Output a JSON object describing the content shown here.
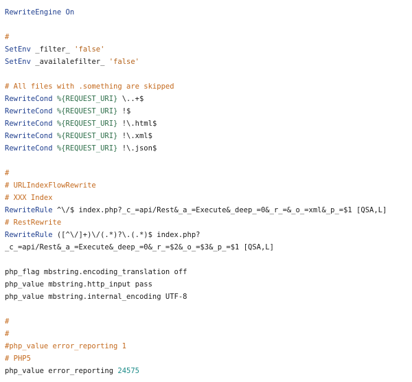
{
  "colors": {
    "keyword": "#1f3f8f",
    "string": "#b4621a",
    "comment": "#c46a1e",
    "variable": "#2f6f4b",
    "number": "#1b8b88",
    "text": "#1a1a1a"
  },
  "lines": [
    {
      "tokens": [
        {
          "t": "kw",
          "v": "RewriteEngine On"
        }
      ]
    },
    {
      "tokens": []
    },
    {
      "tokens": [
        {
          "t": "cm",
          "v": "#"
        }
      ]
    },
    {
      "tokens": [
        {
          "t": "kw",
          "v": "SetEnv "
        },
        {
          "t": "plain",
          "v": "_filter_ "
        },
        {
          "t": "str",
          "v": "'false'"
        }
      ]
    },
    {
      "tokens": [
        {
          "t": "kw",
          "v": "SetEnv "
        },
        {
          "t": "plain",
          "v": "_availalefilter_ "
        },
        {
          "t": "str",
          "v": "'false'"
        }
      ]
    },
    {
      "tokens": []
    },
    {
      "tokens": [
        {
          "t": "cm",
          "v": "# All files with .something are skipped"
        }
      ]
    },
    {
      "tokens": [
        {
          "t": "kw",
          "v": "RewriteCond "
        },
        {
          "t": "var",
          "v": "%{REQUEST_URI}"
        },
        {
          "t": "plain",
          "v": " \\..+$"
        }
      ]
    },
    {
      "tokens": [
        {
          "t": "kw",
          "v": "RewriteCond "
        },
        {
          "t": "var",
          "v": "%{REQUEST_URI}"
        },
        {
          "t": "plain",
          "v": " !$"
        }
      ]
    },
    {
      "tokens": [
        {
          "t": "kw",
          "v": "RewriteCond "
        },
        {
          "t": "var",
          "v": "%{REQUEST_URI}"
        },
        {
          "t": "plain",
          "v": " !\\.html$"
        }
      ]
    },
    {
      "tokens": [
        {
          "t": "kw",
          "v": "RewriteCond "
        },
        {
          "t": "var",
          "v": "%{REQUEST_URI}"
        },
        {
          "t": "plain",
          "v": " !\\.xml$"
        }
      ]
    },
    {
      "tokens": [
        {
          "t": "kw",
          "v": "RewriteCond "
        },
        {
          "t": "var",
          "v": "%{REQUEST_URI}"
        },
        {
          "t": "plain",
          "v": " !\\.json$"
        }
      ]
    },
    {
      "tokens": []
    },
    {
      "tokens": [
        {
          "t": "cm",
          "v": "#"
        }
      ]
    },
    {
      "tokens": [
        {
          "t": "cm",
          "v": "# URLIndexFlowRewrite"
        }
      ]
    },
    {
      "tokens": [
        {
          "t": "cm",
          "v": "# XXX Index"
        }
      ]
    },
    {
      "tokens": [
        {
          "t": "kw",
          "v": "RewriteRule "
        },
        {
          "t": "plain",
          "v": "^\\/$ index.php?_c_=api/Rest&_a_=Execute&_deep_=0&_r_=&_o_=xml&_p_=$1 [QSA,L]"
        }
      ]
    },
    {
      "tokens": [
        {
          "t": "cm",
          "v": "# RestRewrite"
        }
      ]
    },
    {
      "tokens": [
        {
          "t": "kw",
          "v": "RewriteRule "
        },
        {
          "t": "plain",
          "v": "([^\\/]+)\\/(.*)?\\.(.*)$ index.php?"
        }
      ]
    },
    {
      "tokens": [
        {
          "t": "plain",
          "v": "_c_=api/Rest&_a_=Execute&_deep_=0&_r_=$2&_o_=$3&_p_=$1 [QSA,L]"
        }
      ]
    },
    {
      "tokens": []
    },
    {
      "tokens": [
        {
          "t": "plain",
          "v": "php_flag mbstring.encoding_translation off"
        }
      ]
    },
    {
      "tokens": [
        {
          "t": "plain",
          "v": "php_value mbstring.http_input pass"
        }
      ]
    },
    {
      "tokens": [
        {
          "t": "plain",
          "v": "php_value mbstring.internal_encoding UTF-8"
        }
      ]
    },
    {
      "tokens": []
    },
    {
      "tokens": [
        {
          "t": "cm",
          "v": "#"
        }
      ]
    },
    {
      "tokens": [
        {
          "t": "cm",
          "v": "#"
        }
      ]
    },
    {
      "tokens": [
        {
          "t": "cm",
          "v": "#php_value error_reporting 1"
        }
      ]
    },
    {
      "tokens": [
        {
          "t": "cm",
          "v": "# PHP5"
        }
      ]
    },
    {
      "tokens": [
        {
          "t": "plain",
          "v": "php_value error_reporting "
        },
        {
          "t": "num",
          "v": "24575"
        }
      ]
    }
  ]
}
